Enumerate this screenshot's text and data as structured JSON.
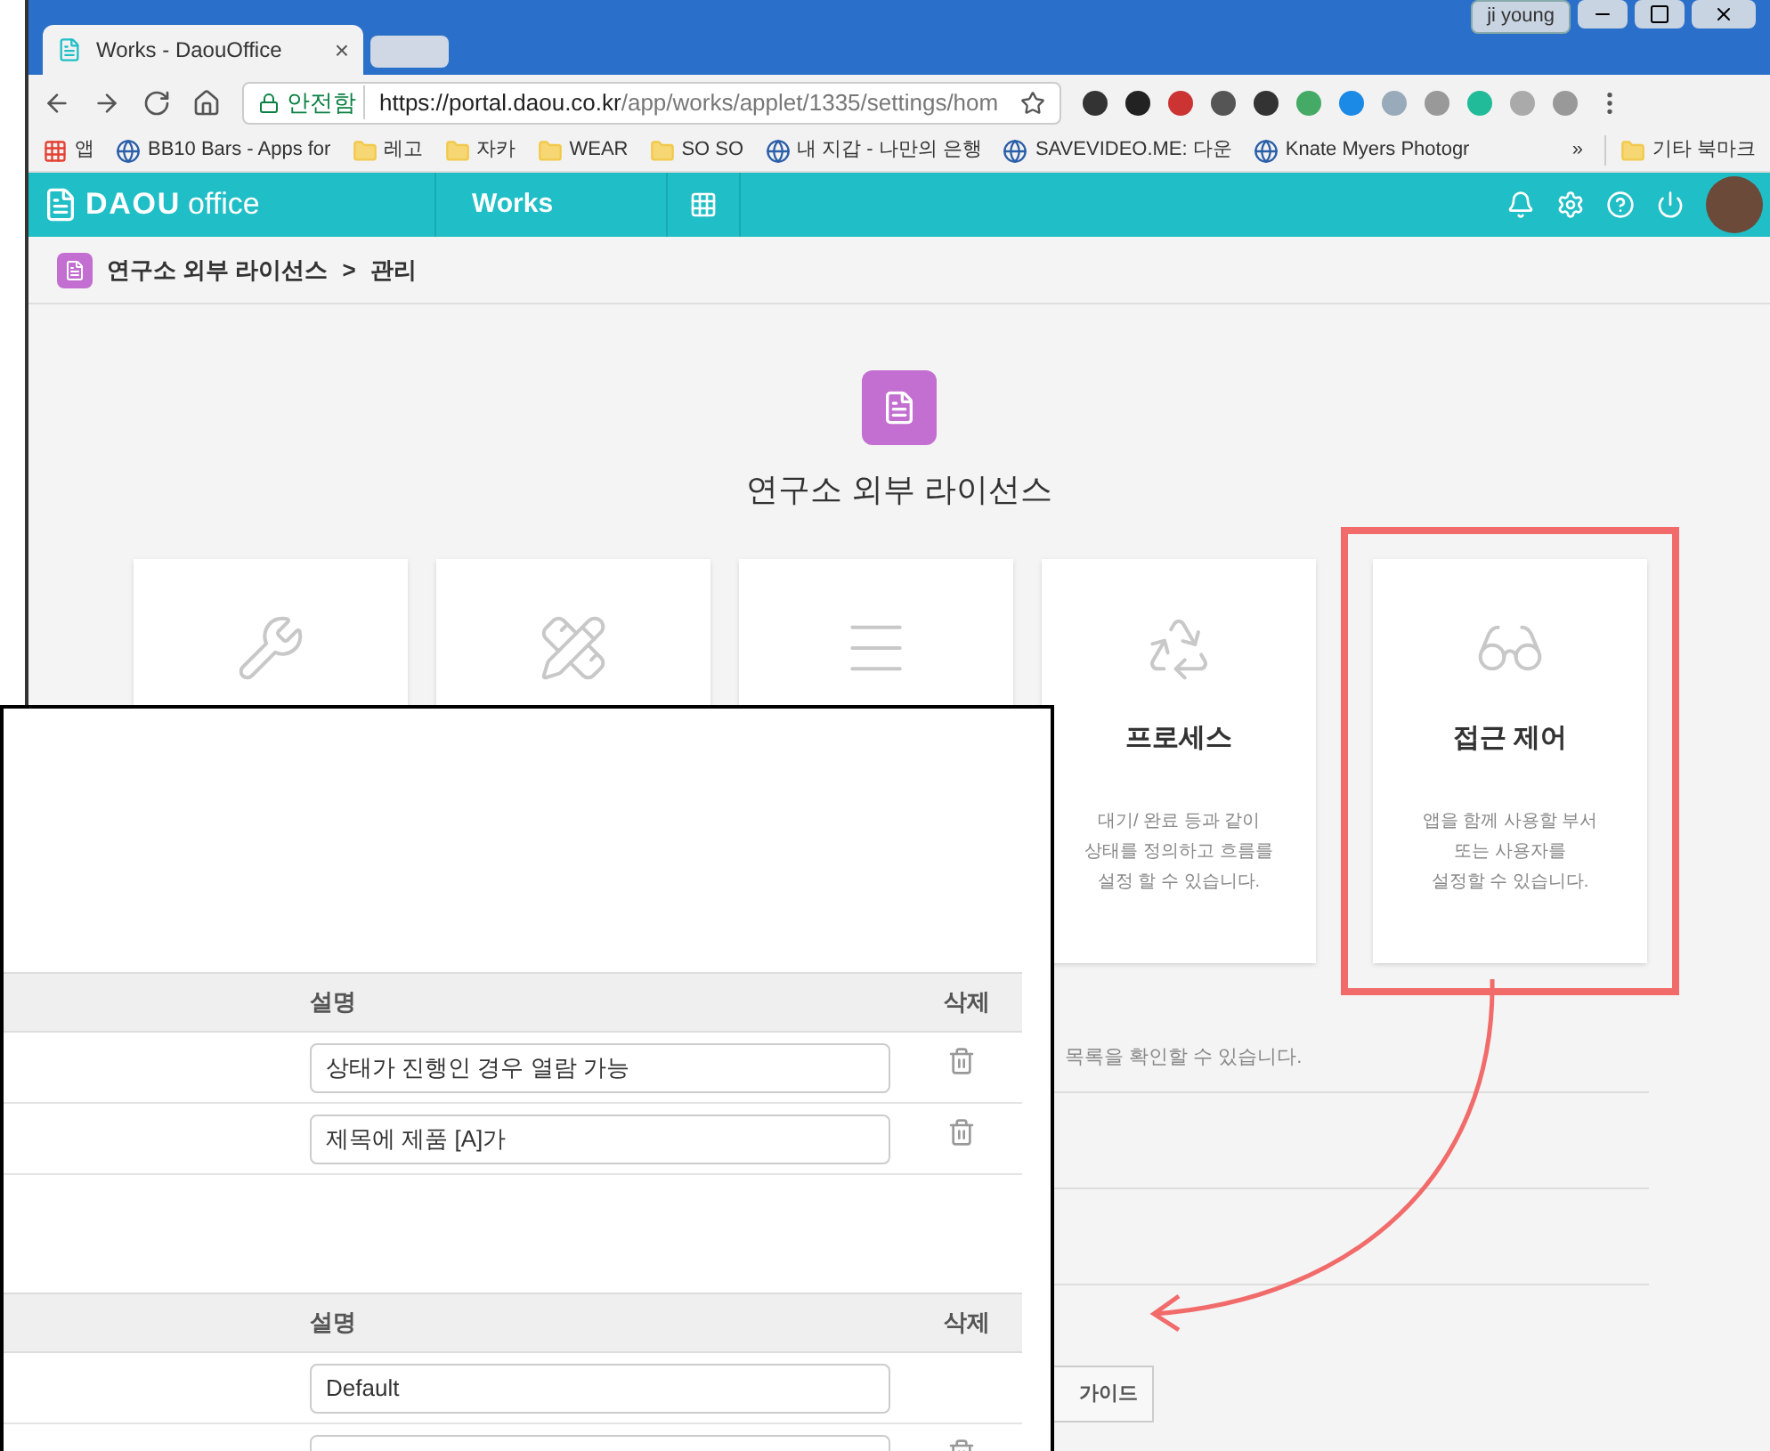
{
  "browser": {
    "tab_title": "Works - DaouOffice",
    "tab_close": "×",
    "profile": "ji young",
    "security": "안전함",
    "url_host": "https://portal.daou.co.kr",
    "url_path": "/app/works/applet/1335/settings/hom",
    "bookmarks": [
      {
        "label": "앱",
        "kind": "apps"
      },
      {
        "label": "BB10 Bars - Apps for",
        "kind": "site"
      },
      {
        "label": "레고",
        "kind": "folder"
      },
      {
        "label": "자카",
        "kind": "folder"
      },
      {
        "label": "WEAR",
        "kind": "folder"
      },
      {
        "label": "SO SO",
        "kind": "folder"
      },
      {
        "label": "내 지갑 - 나만의 은행",
        "kind": "site"
      },
      {
        "label": "SAVEVIDEO.ME: 다운",
        "kind": "site"
      },
      {
        "label": "Knate Myers Photogr",
        "kind": "site"
      }
    ],
    "bookmarks_more": "»",
    "other_bookmarks": "기타 북마크"
  },
  "app": {
    "logo_text": "DAOU",
    "logo_suffix": "office",
    "module": "Works"
  },
  "breadcrumb": {
    "app": "연구소 외부 라이선스",
    "separator": ">",
    "current": "관리"
  },
  "app_title": "연구소 외부 라이선스",
  "cards": [
    {
      "kind": "wrench",
      "highlighted": false
    },
    {
      "kind": "tools",
      "highlighted": false
    },
    {
      "kind": "list",
      "highlighted": false
    },
    {
      "kind": "recycle",
      "title": "프로세스",
      "description": [
        "대기/ 완료 등과 같이",
        "상태를 정의하고 흐름를",
        "설정 할 수 있습니다."
      ],
      "highlighted": false
    },
    {
      "kind": "glasses",
      "title": "접근 제어",
      "description": [
        "앱을 함께 사용할 부서",
        "또는 사용자를",
        "설정할 수 있습니다."
      ],
      "highlighted": true
    }
  ],
  "background": {
    "note": "목록을 확인할 수 있습니다.",
    "button": "가이드"
  },
  "overlay": {
    "tables": [
      {
        "columns": [
          "설명",
          "삭제"
        ],
        "rows": [
          {
            "description": "상태가 진행인 경우 열람 가능",
            "deletable": true
          },
          {
            "description": "제목에 제품 [A]가",
            "deletable": true
          }
        ]
      },
      {
        "columns": [
          "설명",
          "삭제"
        ],
        "rows": [
          {
            "description": "Default",
            "deletable": false
          },
          {
            "deletable": true
          }
        ]
      }
    ]
  }
}
